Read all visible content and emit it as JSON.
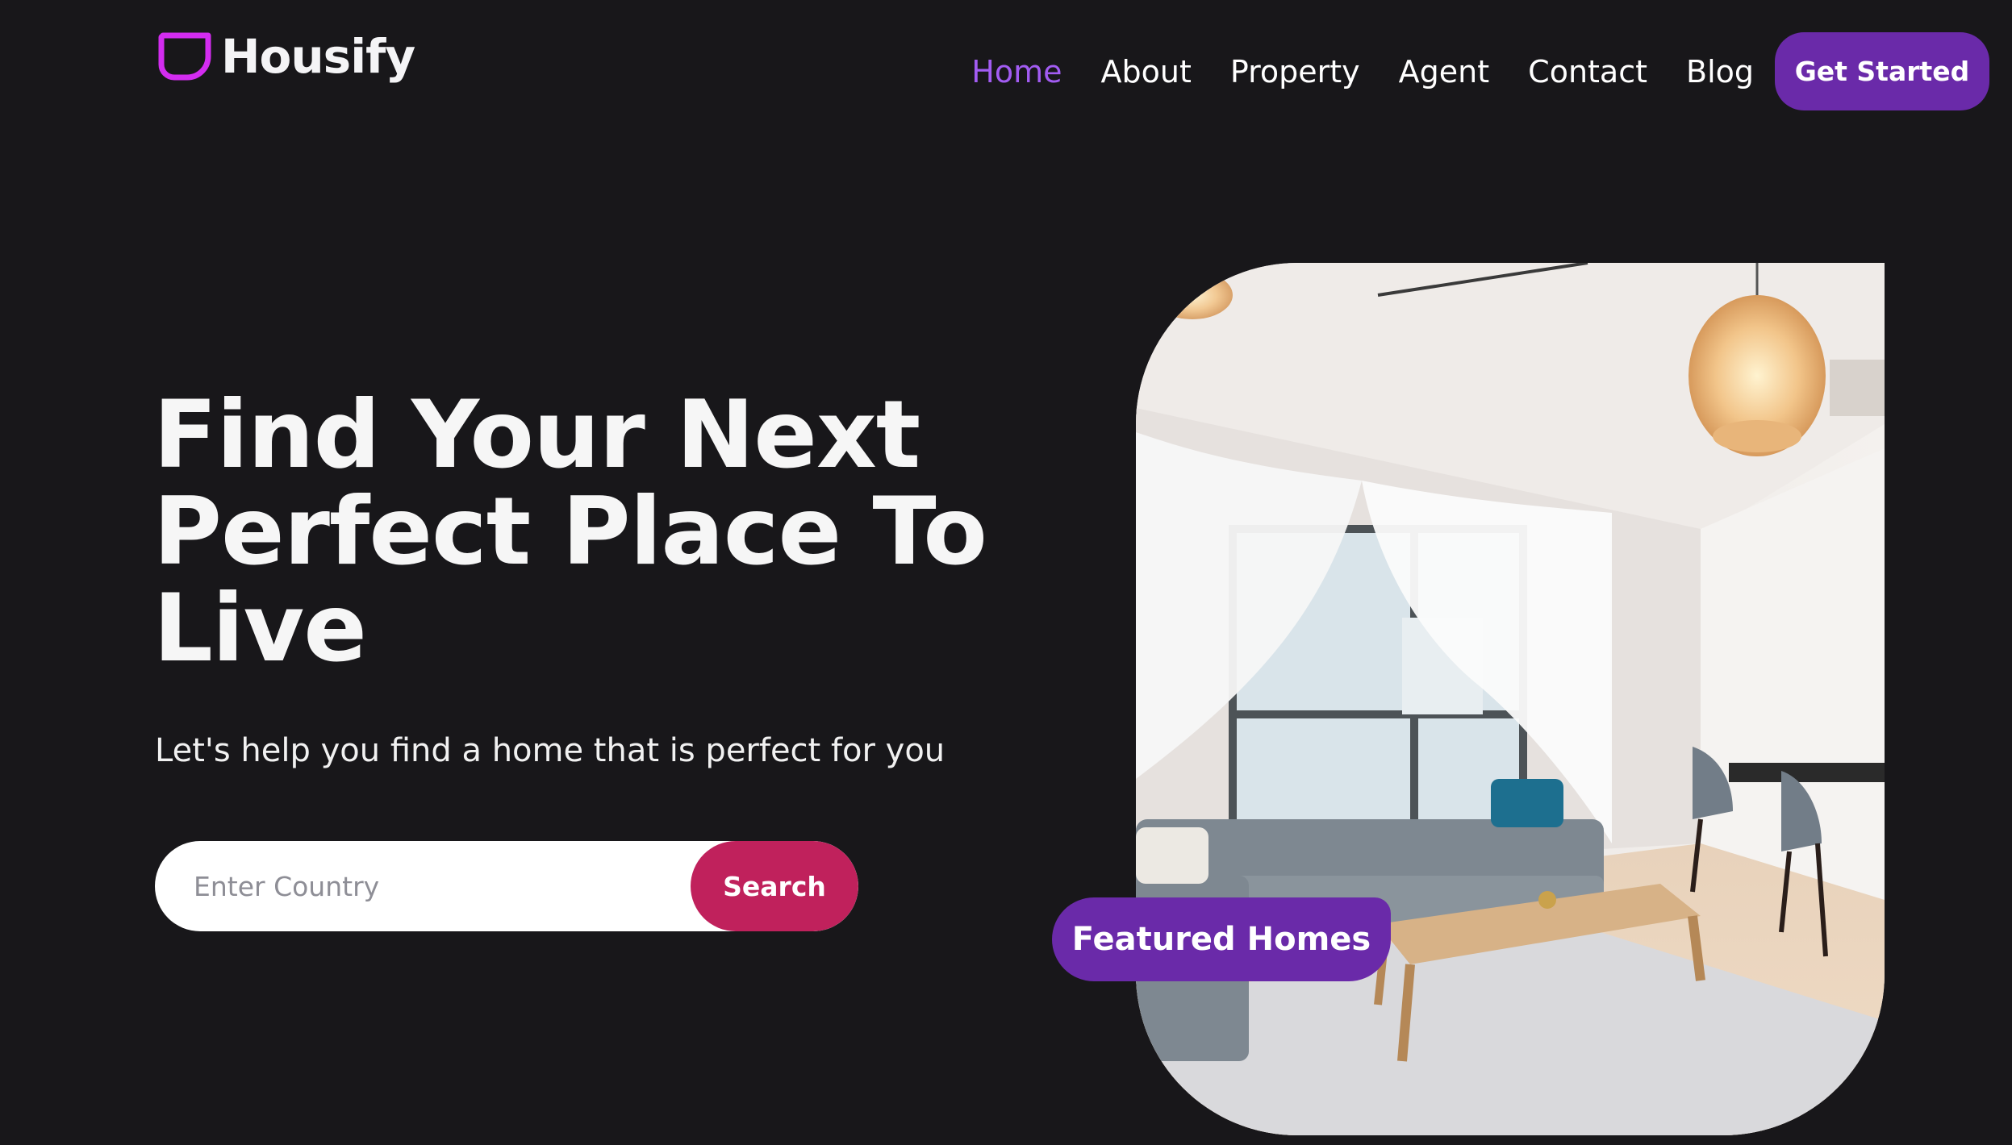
{
  "brand": {
    "name": "Housify",
    "logo_icon": "housify-logo-icon",
    "logo_color": "#d32cf0"
  },
  "nav": {
    "items": [
      {
        "label": "Home",
        "active": true
      },
      {
        "label": "About",
        "active": false
      },
      {
        "label": "Property",
        "active": false
      },
      {
        "label": "Agent",
        "active": false
      },
      {
        "label": "Contact",
        "active": false
      },
      {
        "label": "Blog",
        "active": false
      }
    ],
    "cta_label": "Get Started"
  },
  "hero": {
    "title": "Find Your Next Perfect Place To Live",
    "subtitle": "Let's help you find a home that is perfect for you",
    "search": {
      "placeholder": "Enter Country",
      "value": "",
      "button_label": "Search"
    },
    "image": "living-room-interior-photo",
    "badge_label": "Featured Homes"
  },
  "colors": {
    "background": "#18171a",
    "accent_purple": "#6a2aa9",
    "active_link": "#a25cf2",
    "search_button": "#c0215c"
  }
}
